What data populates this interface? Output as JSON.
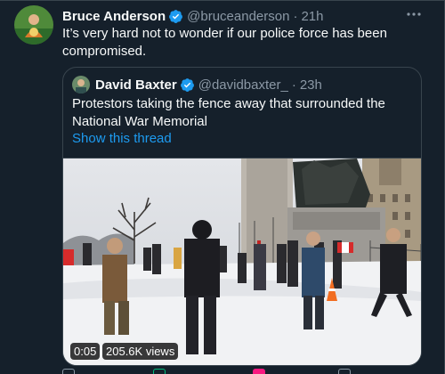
{
  "tweet": {
    "author_name": "Bruce Anderson",
    "author_handle": "@bruceanderson",
    "separator": "·",
    "time": "21h",
    "text": "It’s very hard not to wonder if our police force has been compromised.",
    "more_icon": "more-icon"
  },
  "quoted": {
    "author_name": "David Baxter",
    "author_handle": "@davidbaxter_",
    "separator": "·",
    "time": "23h",
    "text": "Protestors taking the fence away that surrounded the National War Memorial",
    "show_thread": "Show this thread",
    "video": {
      "elapsed": "0:05",
      "views": "205.6K views"
    }
  },
  "colors": {
    "background": "#15202b",
    "link": "#1d9bf0",
    "verified": "#1d9bf0",
    "secondary_text": "#8b98a5",
    "border": "#38444d"
  },
  "icons": [
    "verified-badge-icon",
    "more-icon",
    "reply-icon",
    "retweet-icon",
    "like-icon",
    "share-icon"
  ]
}
